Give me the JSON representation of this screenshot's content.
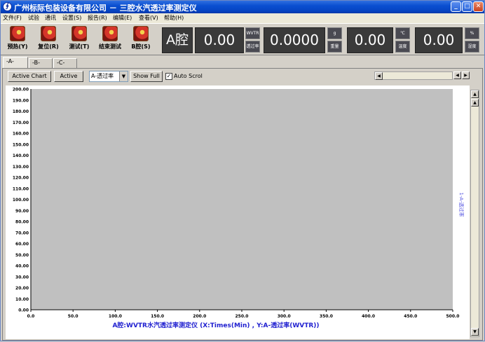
{
  "window": {
    "title": "广州标际包装设备有限公司 － 三腔水汽透过率测定仪",
    "icon_label": "∮",
    "controls": [
      "minimize-icon",
      "maximize-icon",
      "close-icon"
    ]
  },
  "menu": [
    "文件(F)",
    "试验",
    "通讯",
    "设置(S)",
    "报告(R)",
    "编辑(E)",
    "查看(V)",
    "帮助(H)"
  ],
  "toolbar": {
    "buttons": [
      {
        "label": "预热(Y)",
        "icon": "gear-icon"
      },
      {
        "label": "复位(R)",
        "icon": "gear-icon"
      },
      {
        "label": "测试(T)",
        "icon": "gear-icon"
      },
      {
        "label": "结束测试",
        "icon": "gear-icon"
      },
      {
        "label": "B腔(S)",
        "icon": "gear-icon"
      }
    ],
    "cavity_label": "A腔",
    "readouts": [
      {
        "value": "0.00",
        "unit_top": "WVTR",
        "unit_bottom": "透过率"
      },
      {
        "value": "0.0000",
        "unit_top": "g",
        "unit_bottom": "重量"
      },
      {
        "value": "0.00",
        "unit_top": "℃",
        "unit_bottom": "温度"
      },
      {
        "value": "0.00",
        "unit_top": "%",
        "unit_bottom": "湿度"
      }
    ]
  },
  "tabs": [
    "-A-",
    "-B-",
    "-C-"
  ],
  "active_tab": 0,
  "chart_controls": {
    "active_chart_label": "Active Chart",
    "active_label": "Active",
    "series_select": "A-透过率",
    "show_full_label": "Show Full",
    "auto_scroll_label": "Auto Scrol",
    "auto_scroll_checked": true
  },
  "colors": {
    "plot_background": "#c0c0c0",
    "title_text": "#2020d0",
    "series_text": "#5050e0",
    "window_bg": "#d4d0c8"
  },
  "chart_data": {
    "type": "line",
    "title": "A腔:WVTR水汽透过率测定仪 (X:Times(Min) , Y:A-透过率(WVTR))",
    "xlim": [
      0,
      500
    ],
    "ylim": [
      0,
      200
    ],
    "x_ticks": [
      "0.0",
      "50.0",
      "100.0",
      "150.0",
      "200.0",
      "250.0",
      "300.0",
      "350.0",
      "400.0",
      "450.0",
      "500.0"
    ],
    "y_ticks": [
      "0.00",
      "10.00",
      "20.00",
      "30.00",
      "40.00",
      "50.00",
      "60.00",
      "70.00",
      "80.00",
      "90.00",
      "100.00",
      "110.00",
      "120.00",
      "130.00",
      "140.00",
      "150.00",
      "160.00",
      "170.00",
      "180.00",
      "190.00",
      "200.00"
    ],
    "series": [
      {
        "name": "1-A-透过率",
        "values": []
      }
    ],
    "grid": false
  }
}
